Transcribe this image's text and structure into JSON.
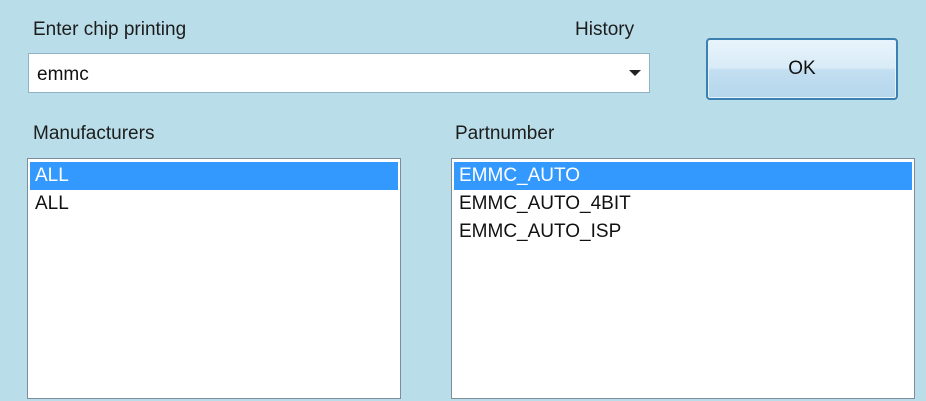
{
  "chip_input": {
    "label": "Enter chip printing",
    "history_label": "History",
    "value": "emmc"
  },
  "ok_button": {
    "label": "OK"
  },
  "manufacturers": {
    "label": "Manufacturers",
    "items": [
      {
        "text": "ALL",
        "selected": true
      },
      {
        "text": "ALL",
        "selected": false
      }
    ]
  },
  "partnumber": {
    "label": "Partnumber",
    "items": [
      {
        "text": "EMMC_AUTO",
        "selected": true
      },
      {
        "text": "EMMC_AUTO_4BIT",
        "selected": false
      },
      {
        "text": "EMMC_AUTO_ISP",
        "selected": false
      }
    ]
  },
  "colors": {
    "background": "#b9dde9",
    "selection": "#3399ff",
    "button_border": "#3c7fb1"
  }
}
